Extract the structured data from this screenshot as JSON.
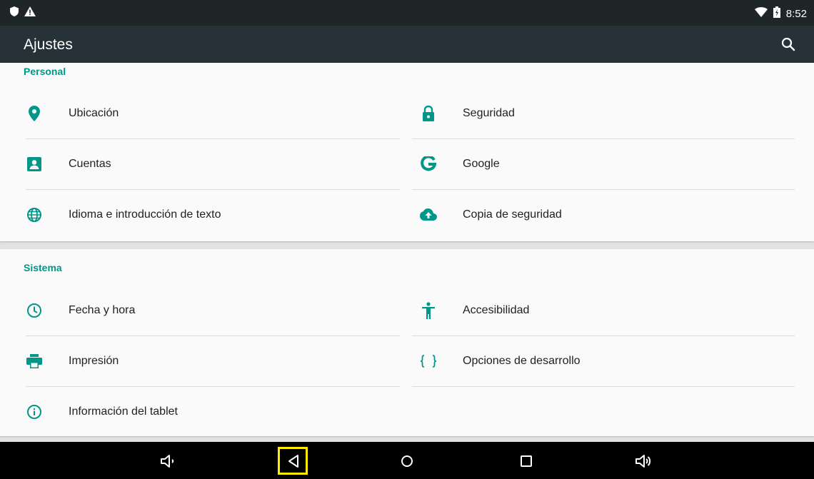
{
  "status_bar": {
    "time": "8:52",
    "icons_left": [
      "shield-icon",
      "warning-icon"
    ],
    "icons_right": [
      "wifi-icon",
      "battery-icon"
    ]
  },
  "toolbar": {
    "title": "Ajustes",
    "search_icon": "search-icon"
  },
  "colors": {
    "accent": "#009688",
    "toolbar": "#263238",
    "statusbar": "#1f2628",
    "highlight": "#ffeb00"
  },
  "sections": {
    "personal": {
      "title": "Personal",
      "items": [
        {
          "label": "Ubicación",
          "icon": "location-icon"
        },
        {
          "label": "Seguridad",
          "icon": "lock-icon"
        },
        {
          "label": "Cuentas",
          "icon": "account-icon"
        },
        {
          "label": "Google",
          "icon": "google-icon"
        },
        {
          "label": "Idioma e introducción de texto",
          "icon": "globe-icon"
        },
        {
          "label": "Copia de seguridad",
          "icon": "cloud-upload-icon"
        }
      ]
    },
    "sistema": {
      "title": "Sistema",
      "items": [
        {
          "label": "Fecha y hora",
          "icon": "clock-icon"
        },
        {
          "label": "Accesibilidad",
          "icon": "accessibility-icon"
        },
        {
          "label": "Impresión",
          "icon": "printer-icon"
        },
        {
          "label": "Opciones de desarrollo",
          "icon": "code-braces-icon"
        },
        {
          "label": "Información del tablet",
          "icon": "info-icon"
        }
      ]
    }
  },
  "navigation_bar": {
    "buttons": [
      "volume-down-icon",
      "back-icon",
      "home-icon",
      "recents-icon",
      "volume-up-icon"
    ]
  }
}
